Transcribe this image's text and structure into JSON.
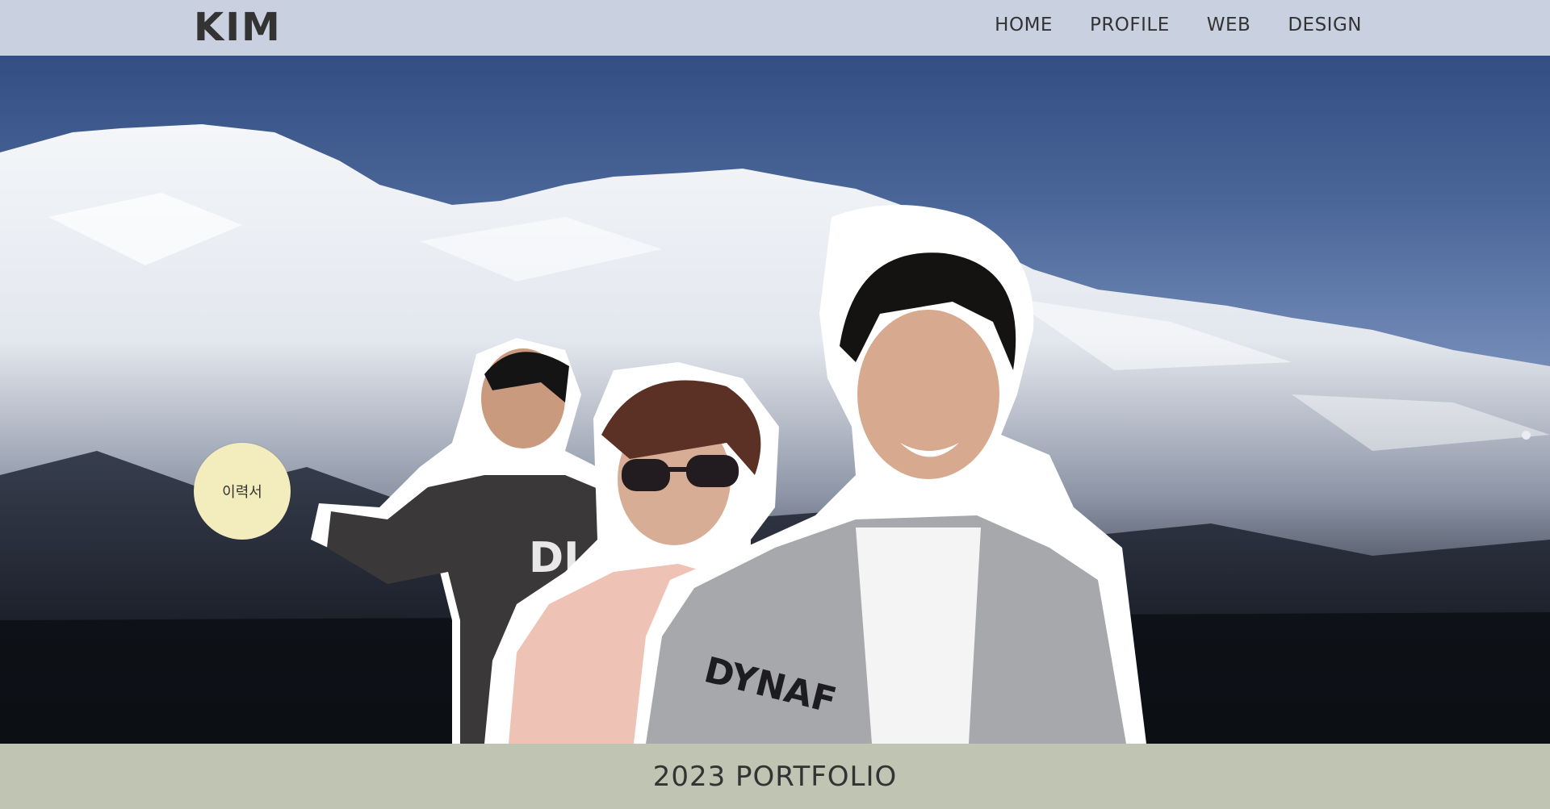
{
  "header": {
    "logo": "KIM",
    "nav": [
      "HOME",
      "PROFILE",
      "WEB",
      "DESIGN"
    ]
  },
  "hero": {
    "resume_label": "이력서",
    "jacket_text_1": "DI",
    "jacket_text_2": "DYNAF"
  },
  "footer": {
    "title": "2023 PORTFOLIO"
  },
  "colors": {
    "header_bg": "#c9d1e0",
    "resume_btn": "#f3ecbd",
    "footer_bg": "#c0c4b3",
    "text": "#333333"
  }
}
